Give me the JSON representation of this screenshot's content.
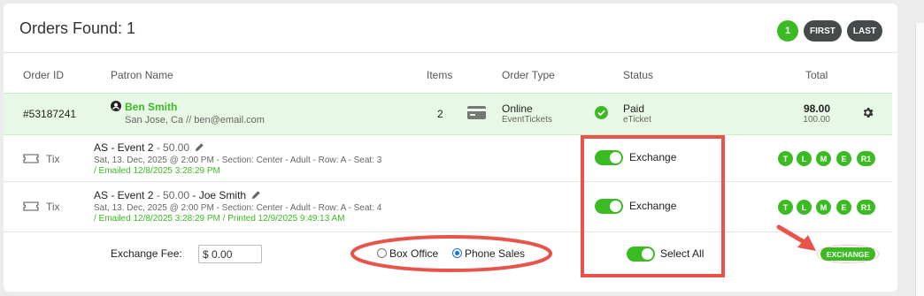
{
  "header": {
    "title": "Orders Found: 1",
    "pager": {
      "page": "1",
      "first": "FIRST",
      "last": "LAST"
    }
  },
  "columns": {
    "order_id": "Order ID",
    "patron": "Patron Name",
    "items": "Items",
    "order_type": "Order Type",
    "status": "Status",
    "total": "Total"
  },
  "order": {
    "id": "#53187241",
    "patron_name": "Ben Smith",
    "patron_info": "San Jose, Ca // ben@email.com",
    "items": "2",
    "type": "Online",
    "type_sub": "EventTickets",
    "status": "Paid",
    "status_sub": "eTicket",
    "total": "98.00",
    "total_sub": "100.00"
  },
  "tickets": [
    {
      "kind": "Tix",
      "event": "AS - Event 2",
      "price": " - 50.00",
      "holder": "",
      "details": "Sat, 13. Dec, 2025 @ 2:00 PM - Section: Center - Adult - Row: A - Seat: 3",
      "history": "/ Emailed 12/8/2025 3:28:29 PM",
      "toggle_label": "Exchange",
      "badges": [
        "T",
        "L",
        "M",
        "E",
        "R1"
      ]
    },
    {
      "kind": "Tix",
      "event": "AS - Event 2",
      "price": " - 50.00",
      "holder": " - Joe Smith",
      "details": "Sat, 13. Dec, 2025 @ 2:00 PM - Section: Center - Adult - Row: A - Seat: 4",
      "history": "/ Emailed 12/8/2025 3:28:29 PM / Printed 12/9/2025 9:49:13 AM",
      "toggle_label": "Exchange",
      "badges": [
        "T",
        "L",
        "M",
        "E",
        "R1"
      ]
    }
  ],
  "footer": {
    "fee_label": "Exchange Fee:",
    "fee_value": "$ 0.00",
    "radio_box_office": "Box Office",
    "radio_phone_sales": "Phone Sales",
    "selected_channel": "Phone Sales",
    "select_all": "Select All",
    "exchange_button": "EXCHANGE"
  },
  "colors": {
    "accent": "#3bbb22",
    "annotation": "#e8534a",
    "dark_button": "#454a4b"
  }
}
